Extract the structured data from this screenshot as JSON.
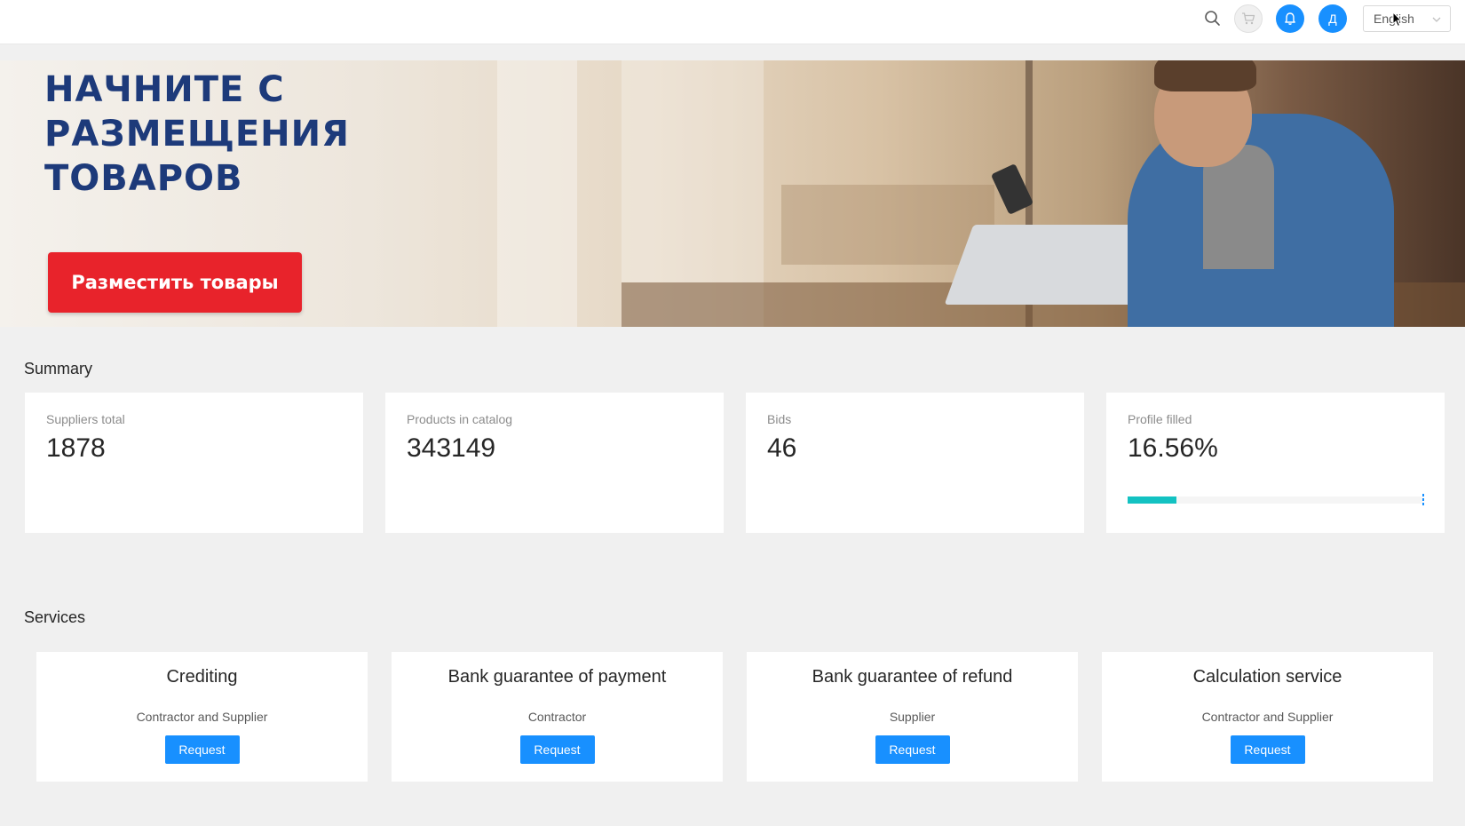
{
  "header": {
    "language": "English",
    "avatar_initial": "Д"
  },
  "banner": {
    "headline_line1": "НАЧНИТЕ С",
    "headline_line2": "РАЗМЕЩЕНИЯ",
    "headline_line3": "ТОВАРОВ",
    "cta_label": "Разместить товары"
  },
  "summary": {
    "title": "Summary",
    "cards": [
      {
        "label": "Suppliers total",
        "value": "1878"
      },
      {
        "label": "Products in catalog",
        "value": "343149"
      },
      {
        "label": "Bids",
        "value": "46"
      },
      {
        "label": "Profile filled",
        "value": "16.56%",
        "progress": 16.56
      }
    ]
  },
  "services": {
    "title": "Services",
    "cards": [
      {
        "title": "Crediting",
        "subtitle": "Contractor and Supplier",
        "button": "Request"
      },
      {
        "title": "Bank guarantee of payment",
        "subtitle": "Contractor",
        "button": "Request"
      },
      {
        "title": "Bank guarantee of refund",
        "subtitle": "Supplier",
        "button": "Request"
      },
      {
        "title": "Calculation service",
        "subtitle": "Contractor and Supplier",
        "button": "Request"
      }
    ]
  },
  "colors": {
    "primary": "#1890ff",
    "cta_red": "#e8232b",
    "headline_blue": "#1d3a7a",
    "progress_teal": "#13c2c2"
  }
}
